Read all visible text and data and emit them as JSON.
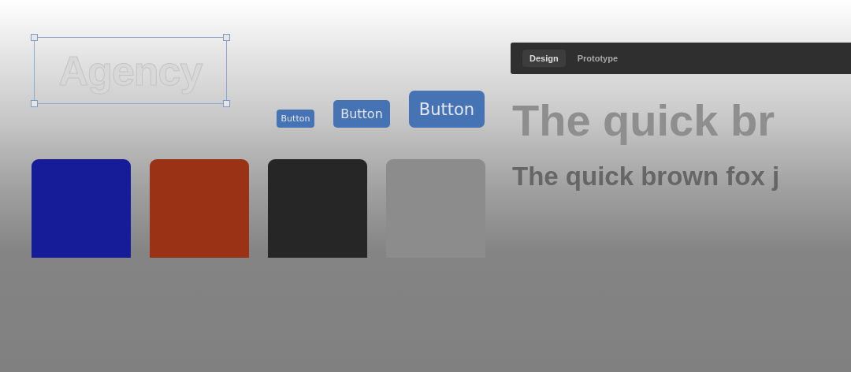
{
  "canvas_text": "Agency",
  "buttons": [
    {
      "label": "Button",
      "kind": "small"
    },
    {
      "label": "Button",
      "kind": "medium"
    },
    {
      "label": "Button",
      "kind": "large"
    }
  ],
  "swatches": [
    {
      "color": "#161c98"
    },
    {
      "color": "#9a3316"
    },
    {
      "color": "#262626"
    },
    {
      "color": "#8c8c8c"
    }
  ],
  "tabs": [
    {
      "label": "Design",
      "selected": true
    },
    {
      "label": "Prototype",
      "selected": false
    }
  ],
  "headings": [
    {
      "text": "The quick br",
      "kind": "large"
    },
    {
      "text": "The quick brown fox j",
      "kind": "medium"
    }
  ]
}
